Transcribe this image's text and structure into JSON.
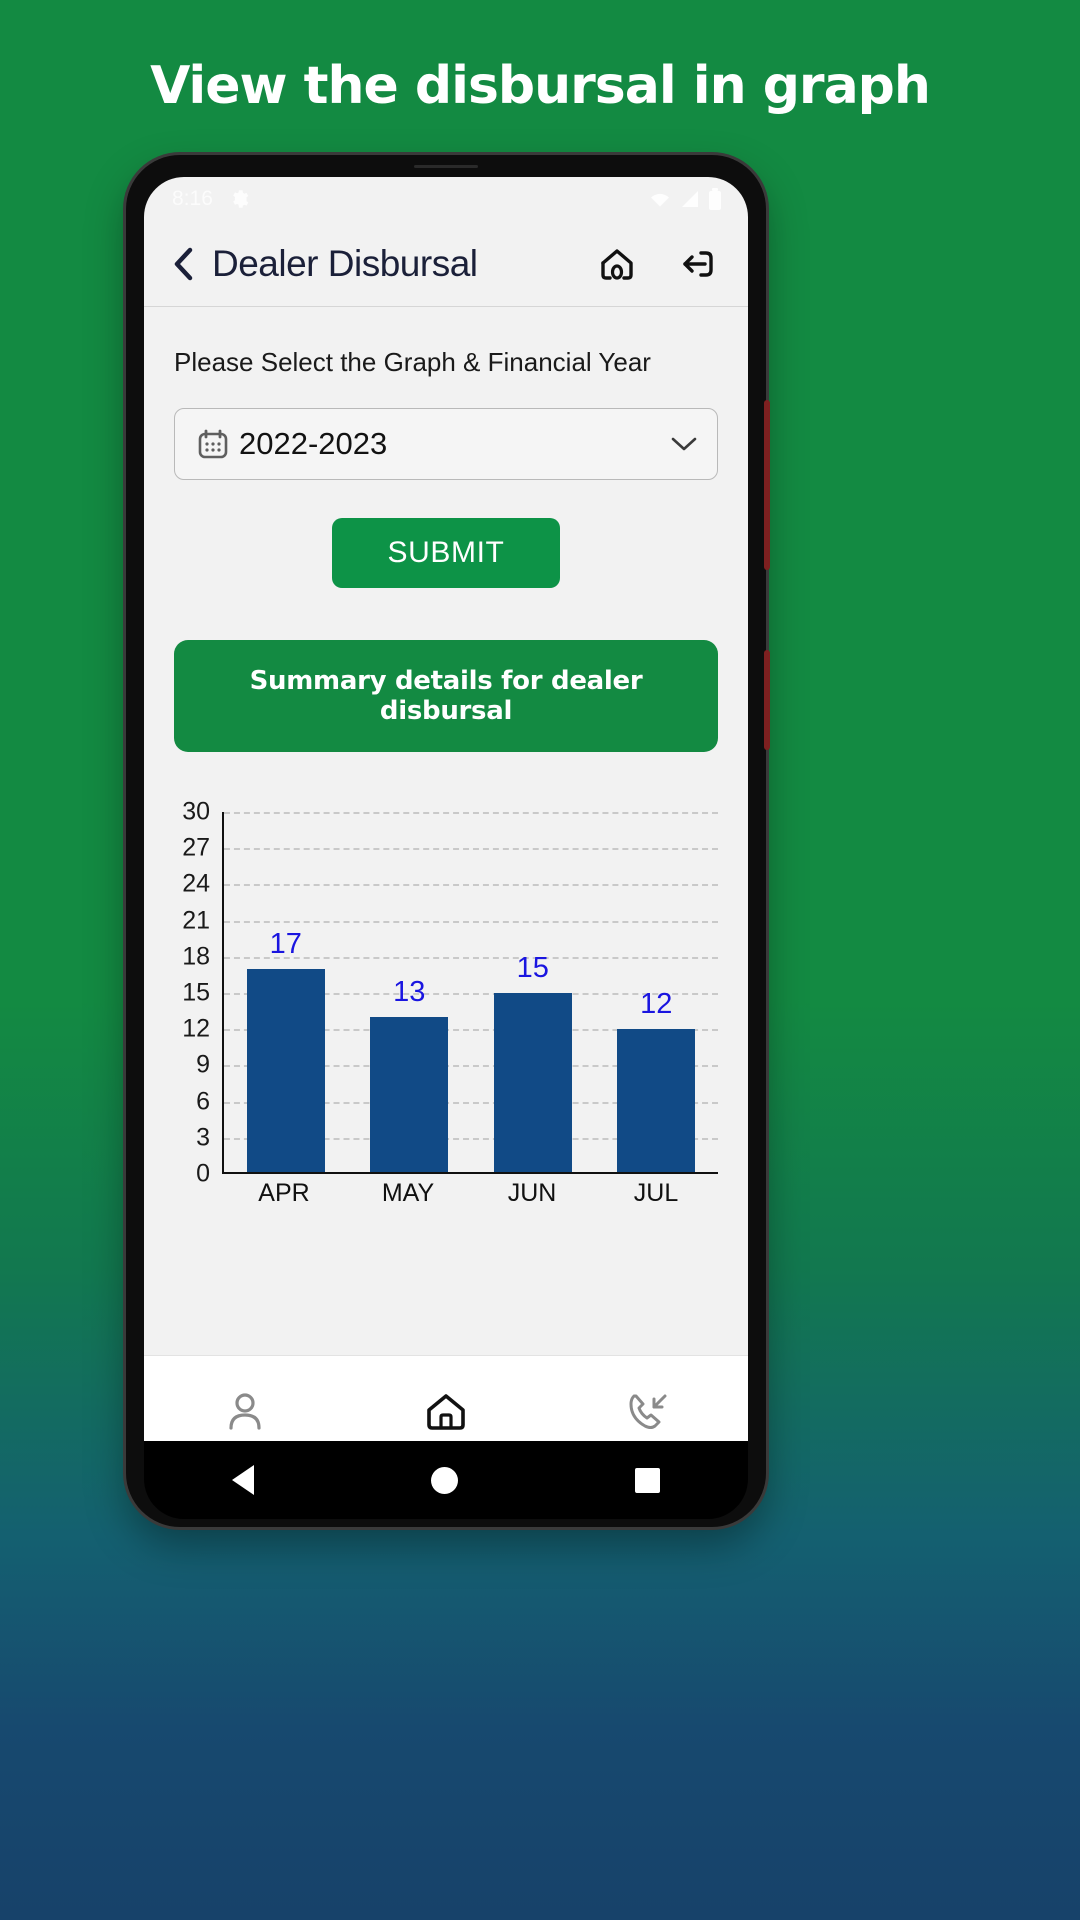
{
  "headline": "View the disbursal in graph",
  "status_bar": {
    "time": "8:16",
    "icons": [
      "gear-icon",
      "wifi-icon",
      "signal-icon",
      "battery-icon"
    ]
  },
  "app_bar": {
    "back_icon": "chevron-left-icon",
    "title": "Dealer Disbursal",
    "home_icon": "home-icon",
    "logout_icon": "logout-icon"
  },
  "form": {
    "label": "Please Select the Graph & Financial Year",
    "select": {
      "calendar_icon": "calendar-icon",
      "value": "2022-2023",
      "chevron_icon": "chevron-down-icon"
    },
    "submit_label": "SUBMIT",
    "summary_banner": "Summary details for dealer disbursal"
  },
  "bottom_nav": [
    {
      "name": "profile",
      "icon": "person-icon"
    },
    {
      "name": "home",
      "icon": "home-icon"
    },
    {
      "name": "calls",
      "icon": "call-received-icon"
    }
  ],
  "android_nav": [
    "back-triangle",
    "home-circle",
    "recents-square"
  ],
  "colors": {
    "brand_green": "#138a42",
    "submit_green": "#0d9347",
    "bar_blue": "#114a86",
    "value_blue": "#1a15e0",
    "screen_bg": "#f2f2f2"
  },
  "chart_data": {
    "type": "bar",
    "title": "",
    "categories": [
      "APR",
      "MAY",
      "JUN",
      "JUL"
    ],
    "values": [
      17,
      13,
      15,
      12
    ],
    "xlabel": "",
    "ylabel": "",
    "ylim": [
      0,
      30
    ],
    "yticks": [
      0,
      3,
      6,
      9,
      12,
      15,
      18,
      21,
      24,
      27,
      30
    ],
    "grid": true,
    "legend": false,
    "data_labels": [
      "17",
      "13",
      "15",
      "12"
    ]
  }
}
